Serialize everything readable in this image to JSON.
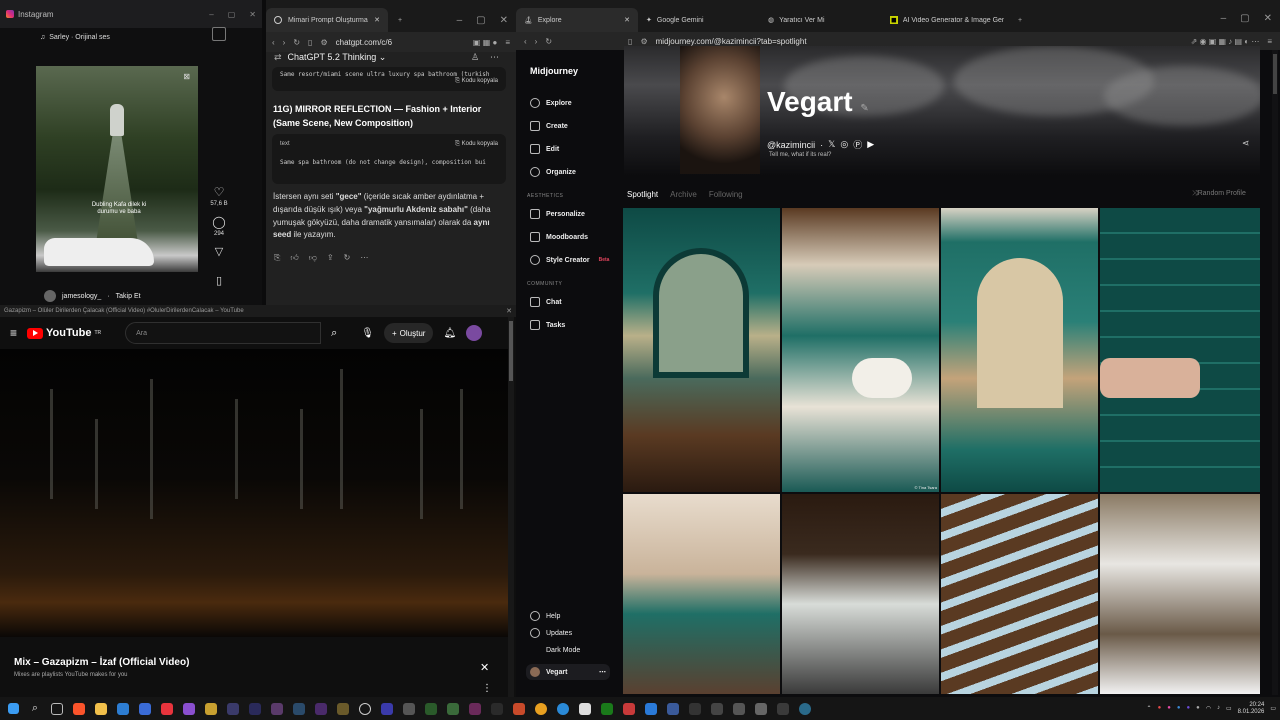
{
  "instagram": {
    "window_title": "Instagram",
    "audio": "Sarley · Orijinal ses",
    "caption": "Dubling\nKafa dilek ki durumu ve baba",
    "likes": "57,6 B",
    "comments": "294",
    "username": "jamesology_",
    "follow": "Takip Et"
  },
  "chatgpt": {
    "tab_title": "Mimari Prompt Oluşturma",
    "url": "chatgpt.com/c/6",
    "model": "ChatGPT 5.2 Thinking",
    "code_top": "Same resort/miami scene ultra luxury spa bathroom (turkish",
    "copy_label": "Kodu kopyala",
    "heading": "11G) MIRROR REFLECTION — Fashion + Interior (Same Scene, New Composition)",
    "code_lang": "text",
    "code_text": "Same spa bathroom (do not change design), composition bui",
    "para_1": "İstersen aynı seti ",
    "para_gece": "\"gece\"",
    "para_2": " (içeride sıcak amber aydınlatma + dışarıda düşük ışık) veya ",
    "para_sabah": "\"yağmurlu Akdeniz sabahı\"",
    "para_3": " (daha yumuşak gökyüzü, daha dramatik yansımalar) olarak da ",
    "para_ayni": "aynı seed",
    "para_4": " ile yazayım."
  },
  "youtube": {
    "window_title": "Gazapizm – Olüler Dirilerden Çalacak (Official Video) #OlulerDirilerdenCalacak – YouTube",
    "logo": "YouTube",
    "logo_sup": "TR",
    "search_placeholder": "Ara",
    "create_label": "Oluştur",
    "mix_title": "Mix – Gazapizm – İzaf (Official Video)",
    "mix_sub": "Mixes are playlists YouTube makes for you"
  },
  "midjourney": {
    "tabs": [
      "Explore",
      "Google Gemini",
      "Yaratıcı Ver Mi",
      "AI Video Generator & Image Generat"
    ],
    "url": "midjourney.com/@kazimincii?tab=spotlight",
    "brand": "Midjourney",
    "nav": [
      "Explore",
      "Create",
      "Edit",
      "Organize"
    ],
    "section_aesthetics": "AESTHETICS",
    "aesthetics": [
      "Personalize",
      "Moodboards",
      "Style Creator"
    ],
    "beta": "Beta",
    "section_community": "COMMUNITY",
    "community": [
      "Chat",
      "Tasks"
    ],
    "bottom": [
      "Help",
      "Updates",
      "Dark Mode"
    ],
    "profile_name": "Vegart",
    "display_name": "Vegart",
    "handle": "@kazimincii",
    "bio": "Tell me, what if its real?",
    "profile_tabs": [
      "Spotlight",
      "Archive",
      "Following"
    ],
    "random_profile": "Random Profile",
    "watermark": "© Tina Tsara"
  },
  "taskbar": {
    "time": "20:24",
    "date": "8.01.2026"
  },
  "colors": {
    "accent_red": "#ff0000",
    "tile_teal": "#1f6f66",
    "beta_red": "#e0445c"
  }
}
